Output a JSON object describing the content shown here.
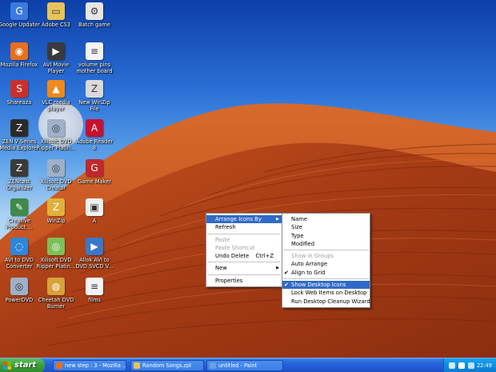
{
  "desktop": {
    "icons": [
      {
        "label": "Google Updater",
        "icon": "google-updater-icon",
        "color": "#3b7be0",
        "glyph": "G"
      },
      {
        "label": "Adobe CS3",
        "icon": "folder-icon",
        "color": "#e8c35a",
        "glyph": "▭"
      },
      {
        "label": "Batch game",
        "icon": "batch-file-icon",
        "color": "#e6e6e6",
        "glyph": "⚙"
      },
      {
        "label": "Mozilla Firefox",
        "icon": "firefox-icon",
        "color": "#e86f1c",
        "glyph": "◉"
      },
      {
        "label": "AVI Movie Player",
        "icon": "movie-player-icon",
        "color": "#3a3a3a",
        "glyph": "▶"
      },
      {
        "label": "volume pins mother board",
        "icon": "document-icon",
        "color": "#f4f4f4",
        "glyph": "≡"
      },
      {
        "label": "Shareaza",
        "icon": "shareaza-icon",
        "color": "#c9302c",
        "glyph": "S"
      },
      {
        "label": "VLC media player",
        "icon": "vlc-icon",
        "color": "#f08a1c",
        "glyph": "▲"
      },
      {
        "label": "New WinZip File",
        "icon": "winzip-file-icon",
        "color": "#d9d9d9",
        "glyph": "Z"
      },
      {
        "label": "ZEN V Series Media Explorer",
        "icon": "zen-media-icon",
        "color": "#2b2b2b",
        "glyph": "Z"
      },
      {
        "label": "Xilisoft DVD Ripper Platin...",
        "icon": "dvd-ripper-icon",
        "color": "#9fb0c8",
        "glyph": "◎"
      },
      {
        "label": "Adobe Reader 8",
        "icon": "adobe-reader-icon",
        "color": "#c8102e",
        "glyph": "A"
      },
      {
        "label": "ZENcast Organizer",
        "icon": "zencast-icon",
        "color": "#3a3a3a",
        "glyph": "Z"
      },
      {
        "label": "Xilisoft DVD Creator",
        "icon": "dvd-creator-icon",
        "color": "#9fb0c8",
        "glyph": "◎"
      },
      {
        "label": "Game Maker",
        "icon": "game-maker-icon",
        "color": "#c0282d",
        "glyph": "G"
      },
      {
        "label": "Creative Product ...",
        "icon": "creative-product-icon",
        "color": "#3d8a4a",
        "glyph": "✎"
      },
      {
        "label": "WinZip",
        "icon": "winzip-icon",
        "color": "#e2b13c",
        "glyph": "Z"
      },
      {
        "label": "A",
        "icon": "application-icon",
        "color": "#f0f0f0",
        "glyph": "▣"
      },
      {
        "label": "AVI to DVD Converter",
        "icon": "avi-dvd-converter-icon",
        "color": "#2f86d8",
        "glyph": "◌"
      },
      {
        "label": "Xilisoft DVD Ripper Platin...",
        "icon": "dvd-ripper-icon",
        "color": "#7fbf5a",
        "glyph": "◎"
      },
      {
        "label": "Allok AVI to DVD SVCD V...",
        "icon": "allok-converter-icon",
        "color": "#3a78c8",
        "glyph": "▶"
      },
      {
        "label": "PowerDVD",
        "icon": "powerdvd-icon",
        "color": "#9fb0c8",
        "glyph": "◎"
      },
      {
        "label": "Cheetah DVD Burner",
        "icon": "cheetah-burner-icon",
        "color": "#d8a23a",
        "glyph": "◍"
      },
      {
        "label": "films",
        "icon": "document-icon",
        "color": "#f4f4f4",
        "glyph": "≡"
      }
    ]
  },
  "context_menu": {
    "items": [
      {
        "label": "Arrange Icons By",
        "submenu": true,
        "highlighted": true
      },
      {
        "label": "Refresh"
      },
      {
        "separator": true
      },
      {
        "label": "Paste",
        "disabled": true
      },
      {
        "label": "Paste Shortcut",
        "disabled": true
      },
      {
        "label": "Undo Delete",
        "shortcut": "Ctrl+Z"
      },
      {
        "separator": true
      },
      {
        "label": "New",
        "submenu": true
      },
      {
        "separator": true
      },
      {
        "label": "Properties"
      }
    ]
  },
  "arrange_submenu": {
    "items": [
      {
        "label": "Name"
      },
      {
        "label": "Size"
      },
      {
        "label": "Type"
      },
      {
        "label": "Modified"
      },
      {
        "separator": true
      },
      {
        "label": "Show in Groups",
        "disabled": true
      },
      {
        "label": "Auto Arrange"
      },
      {
        "label": "Align to Grid",
        "checked": true
      },
      {
        "separator": true
      },
      {
        "label": "Show Desktop Icons",
        "checked": true,
        "highlighted": true
      },
      {
        "label": "Lock Web Items on Desktop"
      },
      {
        "label": "Run Desktop Cleanup Wizard"
      }
    ]
  },
  "taskbar": {
    "start_label": "start",
    "tasks": [
      {
        "label": "new step : 3 - Mozilla ...",
        "icon": "firefox-icon",
        "color": "#e86f1c"
      },
      {
        "label": "Random Songs.zpl",
        "icon": "folder-icon",
        "color": "#e8c35a"
      },
      {
        "label": "untitled - Paint",
        "icon": "paint-icon",
        "color": "#6aa0e0"
      }
    ],
    "tray_icons": [
      "network-icon",
      "volume-icon",
      "display-icon"
    ],
    "clock": "22:49"
  },
  "colors": {
    "menu_highlight": "#316ac5",
    "taskbar_blue": "#245dd7",
    "start_green": "#3c9d36",
    "tray_blue": "#0f8be0"
  }
}
